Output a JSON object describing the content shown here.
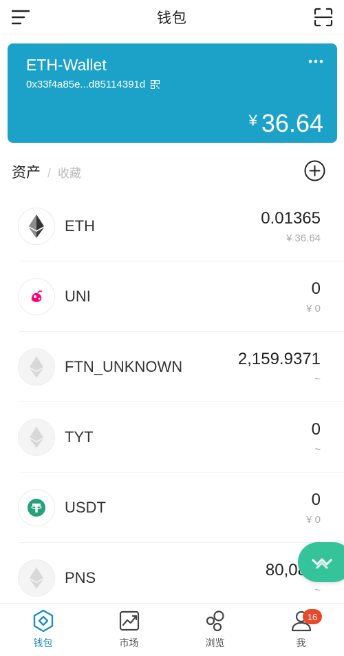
{
  "header": {
    "title": "钱包"
  },
  "wallet": {
    "name": "ETH-Wallet",
    "address": "0x33f4a85e...d85114391d",
    "currency": "¥",
    "balance": "36.64"
  },
  "tabs": {
    "active": "资产",
    "separator": "/",
    "inactive": "收藏"
  },
  "assets": [
    {
      "symbol": "ETH",
      "amount": "0.01365",
      "fiat": "¥ 36.64",
      "icon": "eth-icon"
    },
    {
      "symbol": "UNI",
      "amount": "0",
      "fiat": "¥ 0",
      "icon": "uni-icon"
    },
    {
      "symbol": "FTN_UNKNOWN",
      "amount": "2,159.9371",
      "fiat": "~",
      "icon": "token-placeholder-icon"
    },
    {
      "symbol": "TYT",
      "amount": "0",
      "fiat": "~",
      "icon": "token-placeholder-icon"
    },
    {
      "symbol": "USDT",
      "amount": "0",
      "fiat": "¥ 0",
      "icon": "tether-icon"
    },
    {
      "symbol": "PNS",
      "amount": "80,081.",
      "fiat": "~",
      "icon": "token-placeholder-icon"
    }
  ],
  "nav": [
    {
      "label": "钱包",
      "icon": "wallet-icon",
      "active": true
    },
    {
      "label": "市场",
      "icon": "chart-icon",
      "active": false
    },
    {
      "label": "浏览",
      "icon": "browse-icon",
      "active": false
    },
    {
      "label": "我",
      "icon": "profile-icon",
      "active": false,
      "badge": "16"
    }
  ],
  "colors": {
    "card": "#1ca2c9",
    "accent": "#1a8fc4",
    "float_button": "#35c49a",
    "badge": "#e8492b"
  }
}
